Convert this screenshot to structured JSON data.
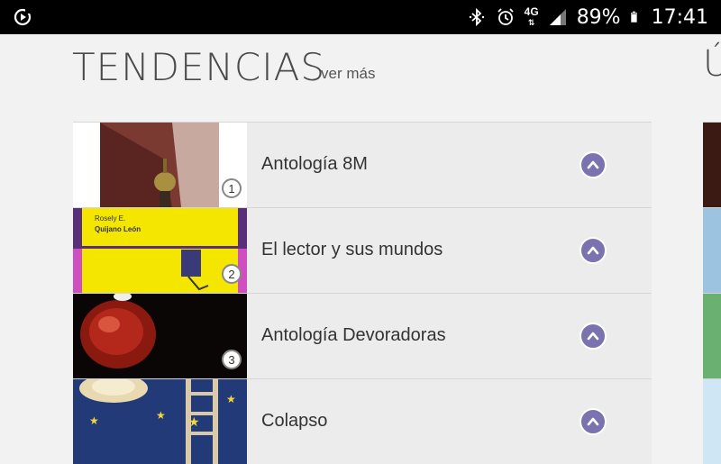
{
  "status_bar": {
    "network": "4G",
    "battery_percent": "89%",
    "time": "17:41"
  },
  "section": {
    "title": "TENDENCIAS",
    "more_link": "ver más",
    "next_section_peek": "Ú"
  },
  "books": [
    {
      "rank": "1",
      "title": "Antología 8M"
    },
    {
      "rank": "2",
      "title": "El lector y sus mundos",
      "cover_text_author": "Rosely E.",
      "cover_text_author2": "Quijano León"
    },
    {
      "rank": "3",
      "title": "Antología Devoradoras"
    },
    {
      "rank": "",
      "title": "Colapso"
    }
  ],
  "colors": {
    "accent": "#7b73b0",
    "background": "#f2f2f2",
    "row_background": "#ececec",
    "status_bar": "#000000"
  }
}
